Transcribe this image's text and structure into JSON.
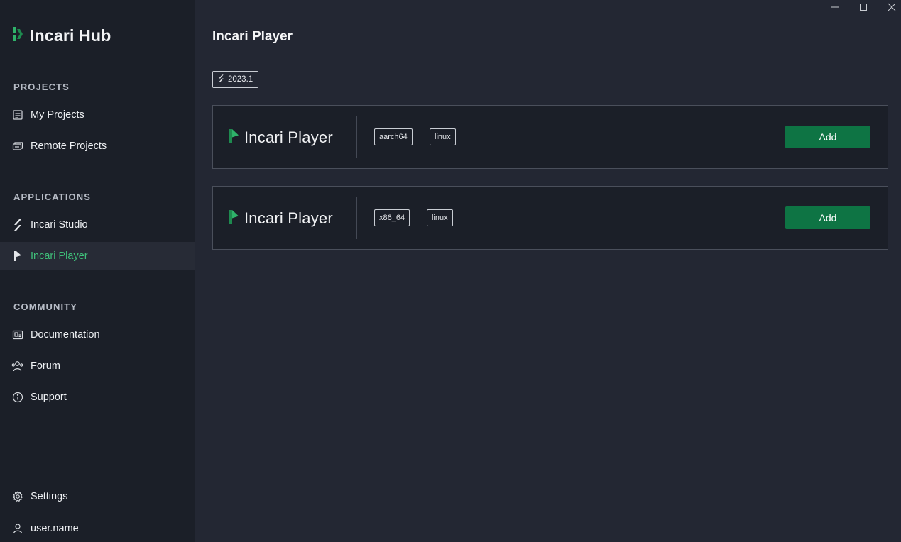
{
  "app": {
    "brand_title": "Incari Hub"
  },
  "window_controls": [
    "minimize-icon",
    "maximize-icon",
    "close-icon"
  ],
  "sidebar": {
    "sections": {
      "projects": "PROJECTS",
      "applications": "APPLICATIONS",
      "community": "COMMUNITY"
    },
    "items": [
      {
        "label": "My Projects",
        "icon": "projects-icon"
      },
      {
        "label": "Remote Projects",
        "icon": "remote-projects-icon"
      },
      {
        "label": "Incari Studio",
        "icon": "incari-studio-icon"
      },
      {
        "label": "Incari Player",
        "icon": "incari-player-icon",
        "active": true
      },
      {
        "label": "Documentation",
        "icon": "documentation-icon"
      },
      {
        "label": "Forum",
        "icon": "forum-icon"
      },
      {
        "label": "Support",
        "icon": "support-icon"
      },
      {
        "label": "Settings",
        "icon": "gear-icon"
      },
      {
        "label": "user.name",
        "icon": "user-icon"
      }
    ]
  },
  "main": {
    "title": "Incari Player",
    "version": "2023.1",
    "players": [
      {
        "name": "Incari Player",
        "arch": "aarch64",
        "os": "linux",
        "action": "Add"
      },
      {
        "name": "Incari Player",
        "arch": "x86_64",
        "os": "linux",
        "action": "Add"
      }
    ]
  },
  "colors": {
    "accent": "#3fbf7a",
    "button": "#0e7444",
    "sidebar_bg": "#1b1f28",
    "main_bg": "#232733"
  }
}
